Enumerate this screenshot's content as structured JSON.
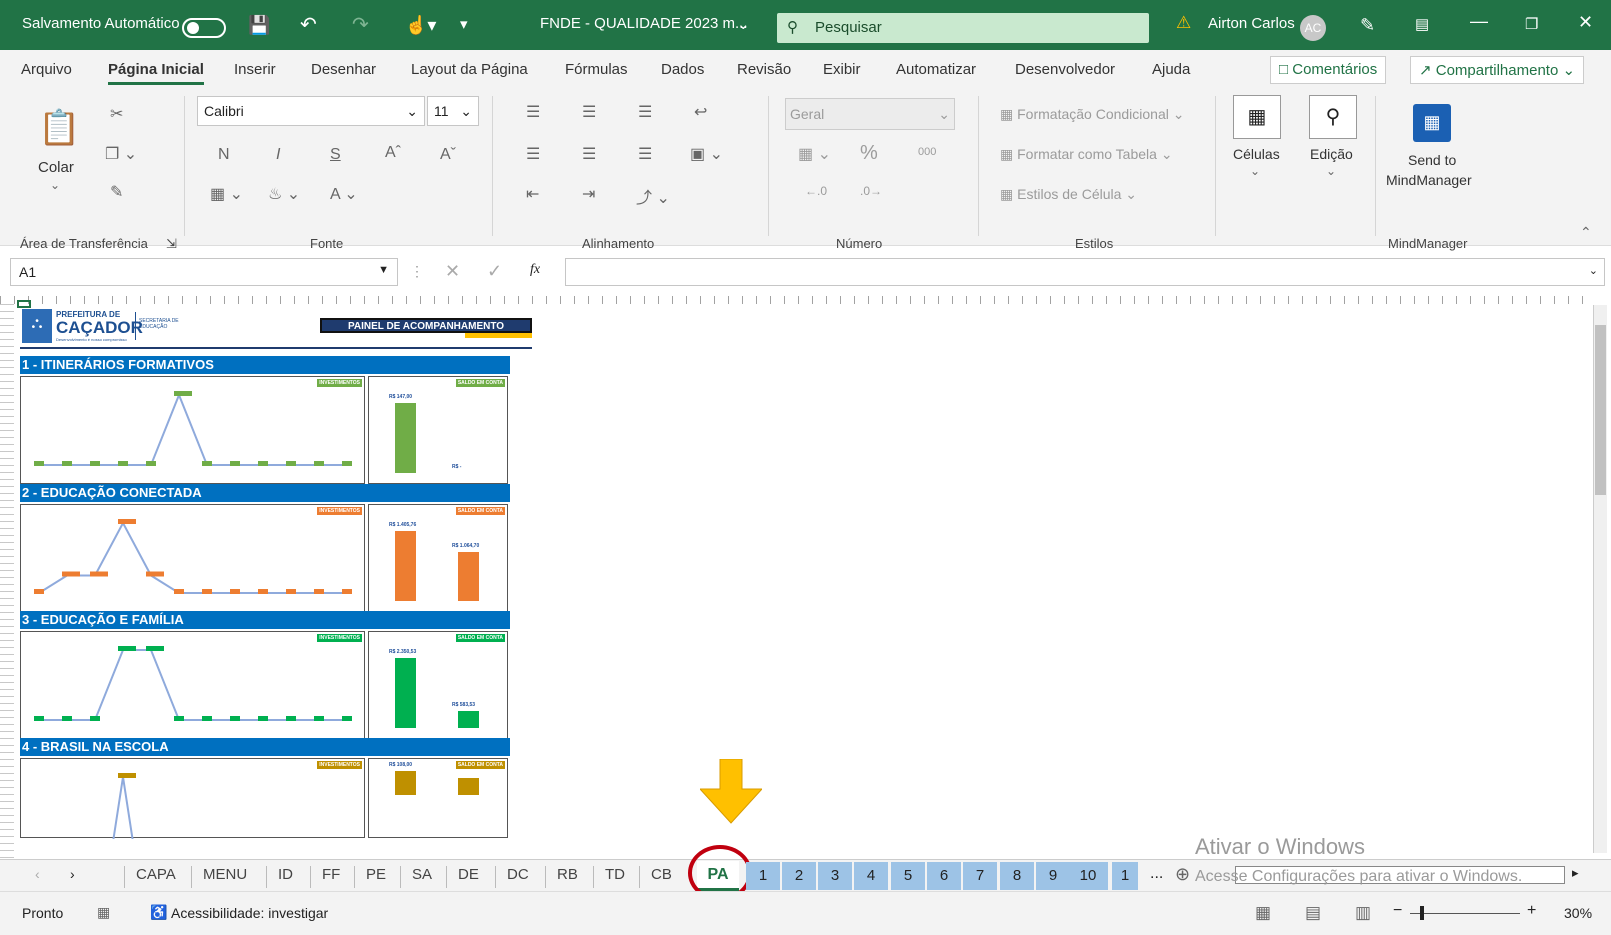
{
  "titlebar": {
    "autosave": "Salvamento Automático",
    "filename": "FNDE - QUALIDADE 2023 m...",
    "search": "Pesquisar",
    "user": "Airton Carlos",
    "initials": "AC"
  },
  "menu": {
    "tabs": [
      "Arquivo",
      "Página Inicial",
      "Inserir",
      "Desenhar",
      "Layout da Página",
      "Fórmulas",
      "Dados",
      "Revisão",
      "Exibir",
      "Automatizar",
      "Desenvolvedor",
      "Ajuda"
    ],
    "comments": "Comentários",
    "share": "Compartilhamento"
  },
  "ribbon": {
    "paste": "Colar",
    "clipboard": "Área de Transferência",
    "font_name": "Calibri",
    "font_size": "11",
    "font": "Fonte",
    "alignment": "Alinhamento",
    "number_format": "Geral",
    "number": "Número",
    "percent": "%",
    "thousands": "000",
    "cond_format": "Formatação Condicional",
    "format_table": "Formatar como Tabela",
    "cell_styles": "Estilos de Célula",
    "styles": "Estilos",
    "cells": "Células",
    "editing": "Edição",
    "send_to": "Send to",
    "mindmanager": "MindManager",
    "mindmanager_group": "MindManager",
    "bold": "N",
    "italic": "I",
    "underline": "S"
  },
  "formula": {
    "cell_ref": "A1",
    "fx": "fx"
  },
  "sheet": {
    "logo_top": "PREFEITURA DE",
    "logo_main": "CAÇADOR",
    "logo_tag": "Desenvolvimento é nosso compromisso",
    "logo_dept": "SECRETARIA DE EDUCAÇÃO",
    "panel_title": "PAINEL DE ACOMPANHAMENTO",
    "sections": [
      {
        "title": "1 - ITINERÁRIOS FORMATIVOS",
        "color": "#70ad47"
      },
      {
        "title": "2 - EDUCAÇÃO CONECTADA",
        "color": "#ed7d31"
      },
      {
        "title": "3 - EDUCAÇÃO E FAMÍLIA",
        "color": "#00b050"
      },
      {
        "title": "4 - BRASIL NA ESCOLA",
        "color": "#bf9000"
      }
    ],
    "invest_label": "INVESTIMENTOS",
    "saldo_label": "SALDO EM CONTA",
    "charts": [
      {
        "line": [
          0,
          0,
          0,
          0,
          0,
          1,
          0,
          0,
          0,
          0,
          0,
          0
        ],
        "bars": [
          1,
          0
        ],
        "bar_labels": [
          "R$ 147,00",
          "R$ -"
        ]
      },
      {
        "line": [
          0,
          0.25,
          0.25,
          1,
          0.25,
          0,
          0,
          0,
          0,
          0,
          0,
          0
        ],
        "bars": [
          1,
          0.7
        ],
        "bar_labels": [
          "R$ 1.405,76",
          "R$ 1.064,70"
        ]
      },
      {
        "line": [
          0,
          0,
          0,
          1,
          1,
          0,
          0,
          0,
          0,
          0,
          0,
          0
        ],
        "bars": [
          1,
          0.25
        ],
        "bar_labels": [
          "R$ 2.350,53",
          "R$ 583,53"
        ]
      },
      {
        "line": [
          0,
          0,
          0,
          1,
          0,
          0,
          0,
          0,
          0,
          0,
          0,
          0
        ],
        "bars": [
          1,
          0.7
        ],
        "bar_labels": [
          "R$ 108,00",
          ""
        ]
      }
    ]
  },
  "tabs": {
    "sheets": [
      "CAPA",
      "MENU",
      "ID",
      "FF",
      "PE",
      "SA",
      "DE",
      "DC",
      "RB",
      "TD",
      "CB",
      "PA"
    ],
    "numbered": [
      "1",
      "2",
      "3",
      "4",
      "5",
      "6",
      "7",
      "8",
      "9",
      "10",
      "1"
    ],
    "more": "...",
    "active": "PA"
  },
  "watermark": {
    "line1": "Ativar o Windows",
    "line2": "Acesse Configurações para ativar o Windows."
  },
  "status": {
    "ready": "Pronto",
    "accessibility": "Acessibilidade: investigar",
    "zoom": "30%"
  }
}
